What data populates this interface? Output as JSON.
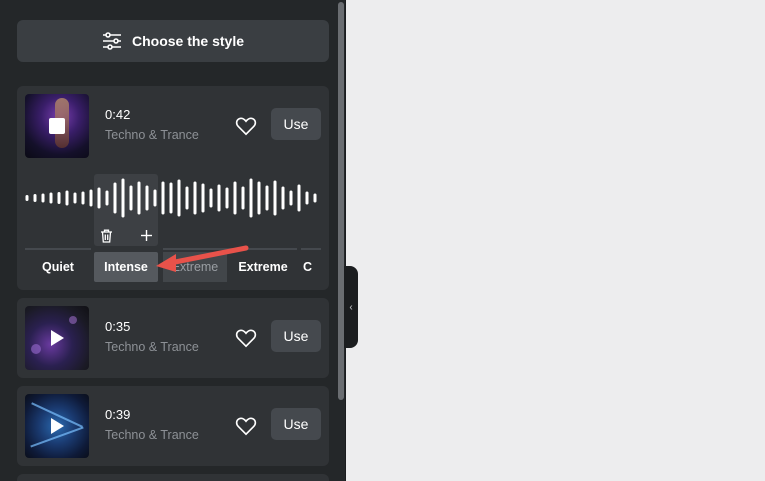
{
  "sidebar": {
    "style_button": {
      "label": "Choose the style",
      "icon": "sliders-icon"
    },
    "tracks": [
      {
        "duration": "0:42",
        "genre": "Techno & Trance",
        "use_label": "Use",
        "state": "playing"
      },
      {
        "duration": "0:35",
        "genre": "Techno & Trance",
        "use_label": "Use",
        "state": "paused"
      },
      {
        "duration": "0:39",
        "genre": "Techno & Trance",
        "use_label": "Use",
        "state": "paused"
      }
    ],
    "segments": [
      {
        "label": "Quiet"
      },
      {
        "label": "Intense",
        "selected": true
      },
      {
        "label": "Extreme"
      },
      {
        "label": "Extreme"
      },
      {
        "label": "C"
      }
    ],
    "segment_tools": {
      "delete_icon": "trash-icon",
      "add_icon": "plus-icon"
    }
  },
  "colors": {
    "panel_bg": "#242729",
    "card_bg": "#303336",
    "canvas_bg": "#ededee",
    "annotation_arrow": "#e8524a"
  }
}
